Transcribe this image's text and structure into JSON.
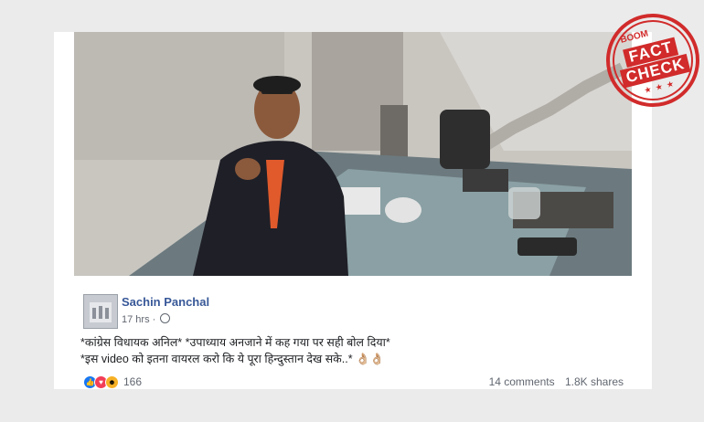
{
  "post": {
    "poster_name": "Sachin Panchal",
    "time": "17 hrs",
    "time_separator": "·",
    "text_line_1": "*कांग्रेस विधायक अनिल* *उपाध्याय अनजाने में कह गया पर सही बोल दिया*",
    "text_line_2": "*इस video को इतना वायरल करो कि ये पूरा हिन्दुस्तान देख सके..*",
    "text_line_2_emoji": "👌🏼👌🏼",
    "reactions_count": "166",
    "comments": "14 comments",
    "shares": "1.8K shares"
  },
  "stamp": {
    "top_text": "BOOM",
    "line_1": "FACT",
    "line_2": "CHECK",
    "stars": "★ ★ ★"
  },
  "colors": {
    "poster_link": "#385898",
    "stamp_red": "#d12b2b",
    "like_blue": "#1877f2"
  },
  "icons": [
    "globe-icon",
    "like-reaction-icon",
    "love-reaction-icon",
    "haha-reaction-icon"
  ]
}
